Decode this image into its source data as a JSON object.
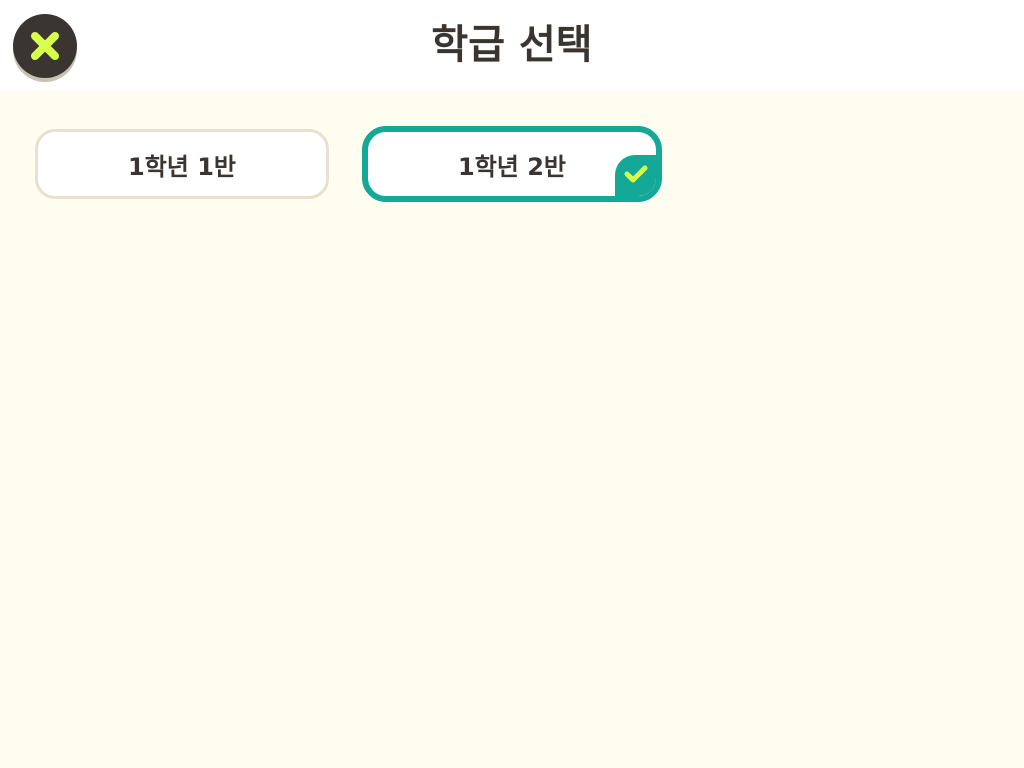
{
  "header": {
    "title": "학급 선택",
    "close_icon": "close-x-icon"
  },
  "classes": [
    {
      "label": "1학년 1반",
      "selected": false
    },
    {
      "label": "1학년 2반",
      "selected": true
    }
  ],
  "colors": {
    "background": "#fffcf0",
    "header_bg": "#ffffff",
    "accent_teal": "#14a896",
    "accent_yellow": "#d9ff4d",
    "dark": "#3a3530",
    "card_border": "#e8e0d0"
  },
  "icons": {
    "selected_check": "check-icon"
  }
}
